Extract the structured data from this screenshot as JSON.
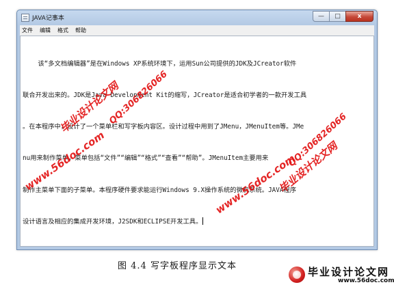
{
  "window": {
    "title": "JAVA记事本",
    "icon": "notepad-icon",
    "buttons": {
      "minimize": "—",
      "maximize": "□",
      "close": "x"
    }
  },
  "menubar": {
    "items": [
      {
        "label": "文件"
      },
      {
        "label": "编辑"
      },
      {
        "label": "格式"
      },
      {
        "label": "帮助"
      }
    ]
  },
  "editor": {
    "lines": [
      "    该“多文档编辑器”是在Windows XP系统环境下，运用Sun公司提供的JDK及JCreator软件",
      "联合开发出来的。JDK是Java Development Kit的缩写，JCreator是适合初学者的一款开发工具",
      "。在本程序中，设计了一个菜单栏和写字板内容区。设计过程中用到了JMenu，JMenuItem等。JMe",
      "nu用来制作菜单，菜单包括“文件”“编辑”“格式”“查看”“帮助”。JMenuItem主要用来",
      "制作主菜单下面的子菜单。本程序硬件要求能运行Windows 9.X操作系统的微机系统。JAVA程序",
      "设计语言及相应的集成开发环境，J2SDK和ECLIPSE开发工具。"
    ]
  },
  "watermarks": {
    "site_name": "毕业设计论文网",
    "url": "www.56doc.com",
    "qq": "QQ:306826066"
  },
  "caption": "图 4.4    写字板程序显示文本",
  "logo": {
    "name": "毕业设计论文网",
    "url": "www.56doc.com"
  },
  "colors": {
    "watermark": "#e21212",
    "titlebar": "#b3c9e4",
    "close_button": "#c6493a"
  }
}
